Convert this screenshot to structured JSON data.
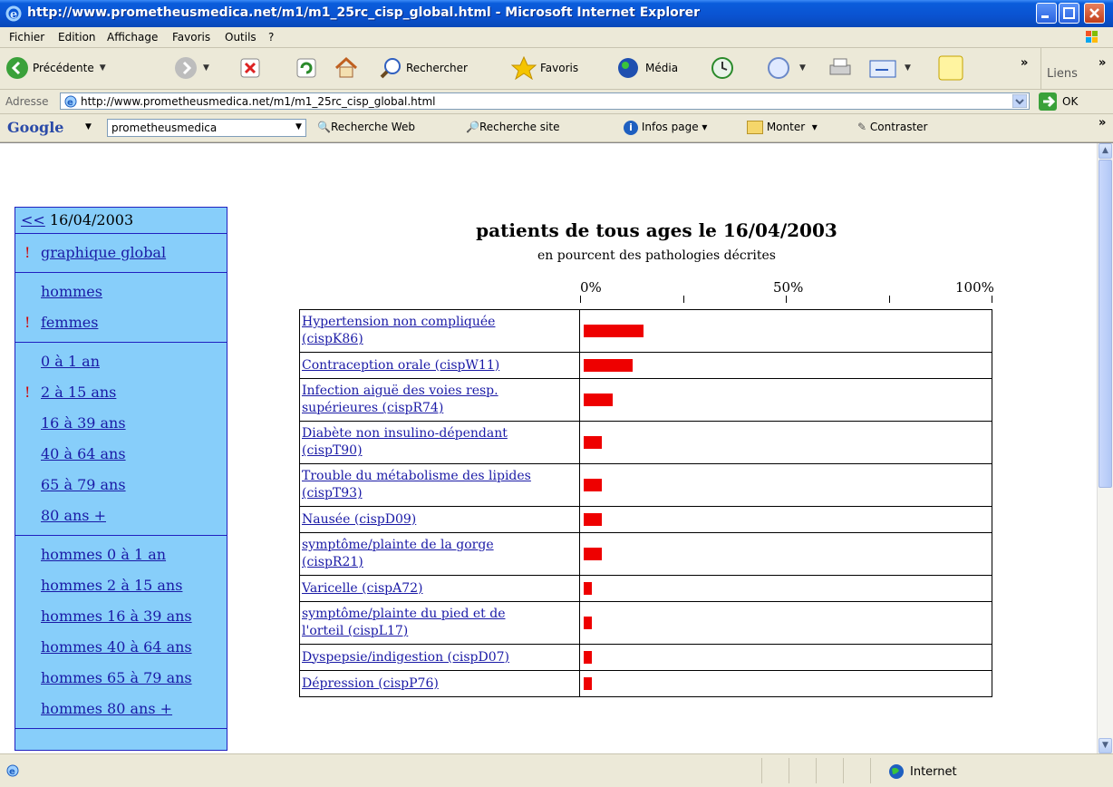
{
  "window": {
    "title": "http://www.prometheusmedica.net/m1/m1_25rc_cisp_global.html - Microsoft Internet Explorer"
  },
  "menu": [
    "Fichier",
    "Edition",
    "Affichage",
    "Favoris",
    "Outils",
    "?"
  ],
  "toolbar": {
    "back": "Précédente",
    "search": "Rechercher",
    "favorites": "Favoris",
    "media": "Média",
    "more": "»",
    "links": "Liens",
    "links_more": "»"
  },
  "address": {
    "label": "Adresse",
    "url": "http://www.prometheusmedica.net/m1/m1_25rc_cisp_global.html",
    "go": "OK"
  },
  "googlebar": {
    "logo": "Google",
    "query": "prometheusmedica",
    "web_search": "Recherche Web",
    "site_search": "Recherche site",
    "page_info": "Infos page",
    "up": "Monter",
    "contrast": "Contraster",
    "more": "»"
  },
  "sidebar": {
    "date_link": "<<",
    "date": "16/04/2003",
    "marker": "!",
    "sections": [
      {
        "items": [
          {
            "label": "graphique global",
            "marked": true
          }
        ]
      },
      {
        "items": [
          {
            "label": "hommes",
            "marked": false
          },
          {
            "label": "femmes",
            "marked": true
          }
        ]
      },
      {
        "items": [
          {
            "label": "0 à 1 an",
            "marked": false
          },
          {
            "label": "2 à 15 ans",
            "marked": true
          },
          {
            "label": "16 à 39 ans",
            "marked": false
          },
          {
            "label": "40 à 64 ans",
            "marked": false
          },
          {
            "label": "65 à 79 ans",
            "marked": false
          },
          {
            "label": "80 ans +",
            "marked": false
          }
        ]
      },
      {
        "items": [
          {
            "label": "hommes 0 à 1 an",
            "marked": false
          },
          {
            "label": "hommes 2 à 15 ans",
            "marked": false
          },
          {
            "label": "hommes 16 à 39 ans",
            "marked": false
          },
          {
            "label": "hommes 40 à 64 ans",
            "marked": false
          },
          {
            "label": "hommes 65 à 79 ans",
            "marked": false
          },
          {
            "label": "hommes 80 ans +",
            "marked": false
          }
        ]
      }
    ]
  },
  "page": {
    "title": "patients de tous ages le 16/04/2003",
    "subtitle": "en pourcent des pathologies décrites"
  },
  "status": {
    "zone": "Internet"
  },
  "colors": {
    "bar": "#ee0000",
    "sidebar_bg": "#87cefa",
    "link": "#1a1aa6"
  },
  "chart_data": {
    "type": "bar",
    "orientation": "horizontal",
    "title": "patients de tous ages le 16/04/2003",
    "subtitle": "en pourcent des pathologies décrites",
    "x_ticks": [
      "0%",
      "50%",
      "100%"
    ],
    "xlim": [
      0,
      100
    ],
    "grid": false,
    "categories": [
      [
        "Hypertension non compliquée",
        "(cispK86)"
      ],
      [
        "Contraception orale (cispW11)"
      ],
      [
        "Infection aiguë des voies resp.",
        "supérieures (cispR74)"
      ],
      [
        "Diabète non insulino-dépendant",
        "(cispT90)"
      ],
      [
        "Trouble du métabolisme des lipides",
        "(cispT93)"
      ],
      [
        "Nausée (cispD09)"
      ],
      [
        "symptôme/plainte de la gorge",
        "(cispR21)"
      ],
      [
        "Varicelle (cispA72)"
      ],
      [
        "symptôme/plainte du pied et de",
        "l'orteil (cispL17)"
      ],
      [
        "Dyspepsie/indigestion (cispD07)"
      ],
      [
        "Dépression (cispP76)"
      ]
    ],
    "values": [
      14.5,
      12,
      7,
      4.5,
      4.5,
      4.5,
      4.5,
      2,
      2,
      2,
      2
    ]
  }
}
